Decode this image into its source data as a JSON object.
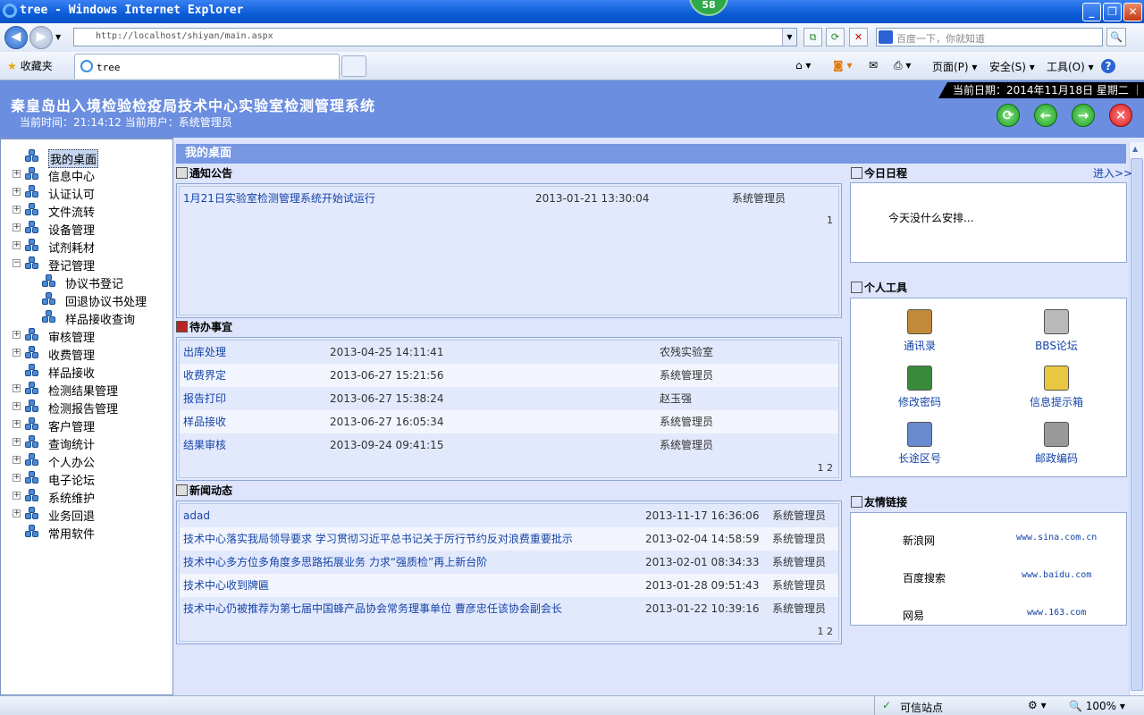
{
  "browser": {
    "window_title": "tree - Windows Internet Explorer",
    "badge": "58",
    "url": "http://localhost/shiyan/main.aspx",
    "search_placeholder": "百度一下，你就知道",
    "favorites_label": "收藏夹",
    "tab_title": "tree",
    "toolbar": {
      "page": "页面(P)",
      "safety": "安全(S)",
      "tools": "工具(O)",
      "help": "?"
    },
    "status": {
      "zone": "可信站点",
      "zoom": "100%"
    }
  },
  "app": {
    "title": "秦皇岛出入境检验检疫局技术中心实验室检测管理系统",
    "current_time_label": "当前时间：21:14:12",
    "current_user_label": "当前用户：系统管理员",
    "date_label": "当前日期：2014年11月18日  星期二  ｜",
    "icons": [
      "refresh-icon",
      "back-arrow-icon",
      "forward-arrow-icon",
      "close-icon"
    ]
  },
  "tree": [
    {
      "label": "我的桌面",
      "level": 0,
      "expander": "",
      "selected": true
    },
    {
      "label": "信息中心",
      "level": 0,
      "expander": "+"
    },
    {
      "label": "认证认可",
      "level": 0,
      "expander": "+"
    },
    {
      "label": "文件流转",
      "level": 0,
      "expander": "+"
    },
    {
      "label": "设备管理",
      "level": 0,
      "expander": "+"
    },
    {
      "label": "试剂耗材",
      "level": 0,
      "expander": "+"
    },
    {
      "label": "登记管理",
      "level": 0,
      "expander": "−"
    },
    {
      "label": "协议书登记",
      "level": 1,
      "expander": ""
    },
    {
      "label": "回退协议书处理",
      "level": 1,
      "expander": ""
    },
    {
      "label": "样品接收查询",
      "level": 1,
      "expander": ""
    },
    {
      "label": "审核管理",
      "level": 0,
      "expander": "+"
    },
    {
      "label": "收费管理",
      "level": 0,
      "expander": "+"
    },
    {
      "label": "样品接收",
      "level": 0,
      "expander": ""
    },
    {
      "label": "检测结果管理",
      "level": 0,
      "expander": "+"
    },
    {
      "label": "检测报告管理",
      "level": 0,
      "expander": "+"
    },
    {
      "label": "客户管理",
      "level": 0,
      "expander": "+"
    },
    {
      "label": "查询统计",
      "level": 0,
      "expander": "+"
    },
    {
      "label": "个人办公",
      "level": 0,
      "expander": "+"
    },
    {
      "label": "电子论坛",
      "level": 0,
      "expander": "+"
    },
    {
      "label": "系统维护",
      "level": 0,
      "expander": "+"
    },
    {
      "label": "业务回退",
      "level": 0,
      "expander": "+"
    },
    {
      "label": "常用软件",
      "level": 0,
      "expander": ""
    }
  ],
  "desk": {
    "title": "我的桌面",
    "notice": {
      "header": "通知公告",
      "rows": [
        {
          "title": "1月21日实验室检测管理系统开始试运行",
          "time": "2013-01-21 13:30:04",
          "user": "系统管理员"
        }
      ],
      "pager": "1"
    },
    "todo": {
      "header": "待办事宜",
      "rows": [
        {
          "title": "出库处理",
          "time": "2013-04-25 14:11:41",
          "user": "农残实验室"
        },
        {
          "title": "收费界定",
          "time": "2013-06-27 15:21:56",
          "user": "系统管理员"
        },
        {
          "title": "报告打印",
          "time": "2013-06-27 15:38:24",
          "user": "赵玉强"
        },
        {
          "title": "样品接收",
          "time": "2013-06-27 16:05:34",
          "user": "系统管理员"
        },
        {
          "title": "结果审核",
          "time": "2013-09-24 09:41:15",
          "user": "系统管理员"
        }
      ],
      "pager": "1 2"
    },
    "news": {
      "header": "新闻动态",
      "rows": [
        {
          "title": "adad",
          "time": "2013-11-17 16:36:06",
          "user": "系统管理员"
        },
        {
          "title": "技术中心落实我局领导要求 学习贯彻习近平总书记关于厉行节约反对浪费重要批示",
          "time": "2013-02-04 14:58:59",
          "user": "系统管理员"
        },
        {
          "title": "技术中心多方位多角度多思路拓展业务 力求“强质检”再上新台阶",
          "time": "2013-02-01 08:34:33",
          "user": "系统管理员"
        },
        {
          "title": "技术中心收到牌匾",
          "time": "2013-01-28 09:51:43",
          "user": "系统管理员"
        },
        {
          "title": "技术中心仍被推荐为第七届中国蜂产品协会常务理事单位 曹彦忠任该协会副会长",
          "time": "2013-01-22 10:39:16",
          "user": "系统管理员"
        }
      ],
      "pager": "1 2"
    },
    "schedule": {
      "header": "今日日程",
      "more": "进入>>",
      "text": "今天没什么安排..."
    },
    "tools": {
      "header": "个人工具",
      "items": [
        {
          "label": "通讯录",
          "icon": "address-book-icon",
          "color": "#c08a3a"
        },
        {
          "label": "BBS论坛",
          "icon": "clipboard-icon",
          "color": "#b9b9b9"
        },
        {
          "label": "修改密码",
          "icon": "globe-key-icon",
          "color": "#3a8a3a"
        },
        {
          "label": "信息提示箱",
          "icon": "calendar-icon",
          "color": "#e8c840"
        },
        {
          "label": "长途区号",
          "icon": "binder-icon",
          "color": "#6a8ad0"
        },
        {
          "label": "邮政编码",
          "icon": "phone-icon",
          "color": "#999999"
        }
      ]
    },
    "links": {
      "header": "友情链接",
      "items": [
        {
          "name": "新浪网",
          "url": "www.sina.com.cn"
        },
        {
          "name": "百度搜索",
          "url": "www.baidu.com"
        },
        {
          "name": "网易",
          "url": "www.163.com"
        }
      ]
    }
  }
}
